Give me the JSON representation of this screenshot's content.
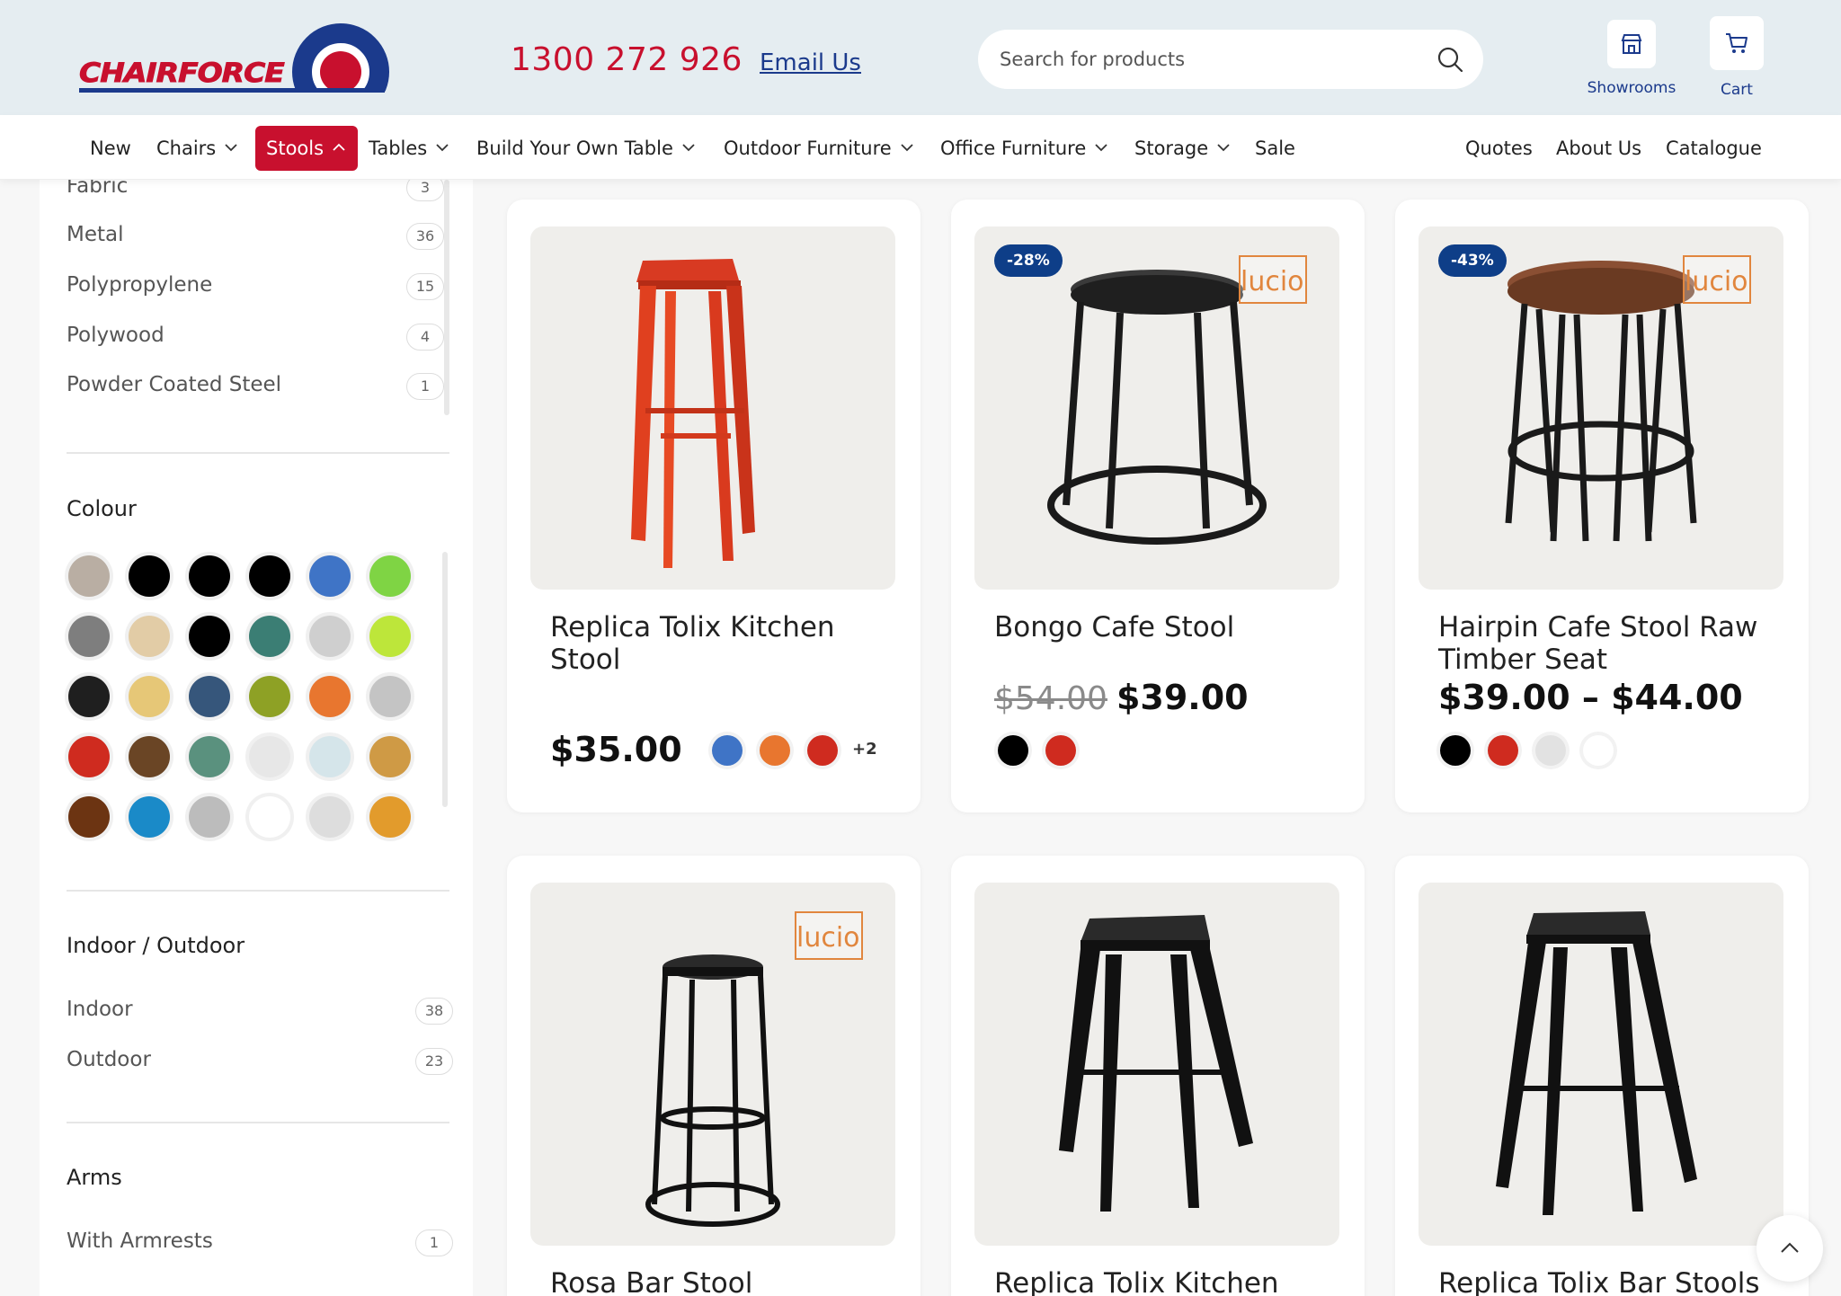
{
  "header": {
    "logo_text": "CHAIRFORCE",
    "phone": "1300 272 926",
    "email_label": "Email Us",
    "search_placeholder": "Search for products",
    "showrooms_label": "Showrooms",
    "cart_label": "Cart"
  },
  "nav": {
    "left": [
      {
        "label": "New",
        "chevron": false
      },
      {
        "label": "Chairs",
        "chevron": true
      },
      {
        "label": "Stools",
        "chevron": true,
        "active": true
      },
      {
        "label": "Tables",
        "chevron": true
      },
      {
        "label": "Build Your Own Table",
        "chevron": true
      },
      {
        "label": "Outdoor Furniture",
        "chevron": true
      },
      {
        "label": "Office Furniture",
        "chevron": true
      },
      {
        "label": "Storage",
        "chevron": true
      },
      {
        "label": "Sale",
        "chevron": false
      }
    ],
    "right": [
      {
        "label": "Quotes"
      },
      {
        "label": "About Us"
      },
      {
        "label": "Catalogue"
      }
    ]
  },
  "sidebar": {
    "material_items": [
      {
        "name": "Fabric",
        "count": "3"
      },
      {
        "name": "Metal",
        "count": "36"
      },
      {
        "name": "Polypropylene",
        "count": "15"
      },
      {
        "name": "Polywood",
        "count": "4"
      },
      {
        "name": "Powder Coated Steel",
        "count": "1"
      }
    ],
    "colour_title": "Colour",
    "colours": [
      "#b9aea3",
      "#000000",
      "#000000",
      "#000000",
      "#3f74c6",
      "#7fd444",
      "#7e7e7e",
      "#e2cca6",
      "#000000",
      "#3b7e74",
      "#cfcfcf",
      "#bde63a",
      "#1f1f1f",
      "#e6c777",
      "#36567b",
      "#8ea125",
      "#e8762f",
      "#c4c4c4",
      "#cf2b1f",
      "#6a4525",
      "#5a917e",
      "#e7e7e7",
      "#d5e5ea",
      "#cf9a45",
      "#6c3412",
      "#1a8ac8",
      "#bcbcbc",
      "#ffffff",
      "#dddddd",
      "#e29b2c"
    ],
    "indoor_title": "Indoor / Outdoor",
    "indoor_items": [
      {
        "name": "Indoor",
        "count": "38"
      },
      {
        "name": "Outdoor",
        "count": "23"
      }
    ],
    "arms_title": "Arms",
    "arms_items": [
      {
        "name": "With Armrests",
        "count": "1"
      }
    ]
  },
  "products": [
    {
      "title": "Replica Tolix Kitchen Stool",
      "price": "$35.00",
      "old_price": "",
      "badge": "",
      "lucio": false,
      "colours": [
        "#3f74c6",
        "#e8762f",
        "#cf2b1f"
      ],
      "more": "+2"
    },
    {
      "title": "Bongo Cafe Stool",
      "price": "$39.00",
      "old_price": "$54.00",
      "badge": "-28%",
      "lucio": true,
      "colours": [
        "#000000",
        "#cf2b1f"
      ],
      "more": ""
    },
    {
      "title": "Hairpin Cafe Stool Raw Timber Seat",
      "price": "$39.00 – $44.00",
      "old_price": "",
      "badge": "-43%",
      "lucio": true,
      "colours": [
        "#000000",
        "#cf2b1f",
        "#e2e2e2",
        "#ffffff"
      ],
      "more": ""
    },
    {
      "title": "Rosa Bar Stool",
      "price": "",
      "old_price": "",
      "badge": "",
      "lucio": true,
      "colours": [],
      "more": ""
    },
    {
      "title": "Replica Tolix Kitchen",
      "price": "",
      "old_price": "",
      "badge": "",
      "lucio": false,
      "colours": [],
      "more": ""
    },
    {
      "title": "Replica Tolix Bar Stools",
      "price": "",
      "old_price": "",
      "badge": "",
      "lucio": false,
      "colours": [],
      "more": ""
    }
  ],
  "lucio_label": "lucio"
}
